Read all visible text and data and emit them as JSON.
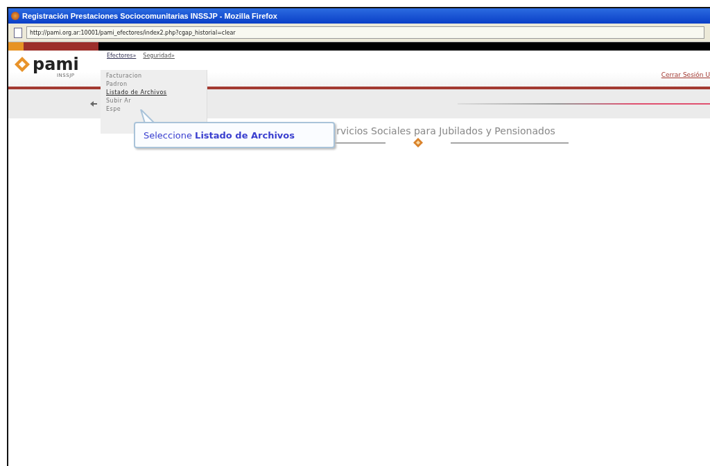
{
  "window": {
    "title": "Registración Prestaciones Sociocomunitarias INSSJP - Mozilla Firefox"
  },
  "address_bar": {
    "url": "http://pami.org.ar:10001/pami_efectores/index2.php?cgap_historial=clear"
  },
  "logo": {
    "name": "pami",
    "subtitle": "INSSJP"
  },
  "menu": [
    {
      "label": "Efectores»",
      "expanded": true
    },
    {
      "label": "Seguridad»",
      "expanded": false
    }
  ],
  "dropdown": [
    {
      "label": "Facturacion",
      "selected": false
    },
    {
      "label": "Padron",
      "selected": false
    },
    {
      "label": "Listado de Archivos",
      "selected": true
    },
    {
      "label": "Subir Ar",
      "selected": false
    },
    {
      "label": "Espe",
      "selected": false
    }
  ],
  "logout_link": "Cerrar Sesión U",
  "tooltip": {
    "text": "Seleccione **Listado de Archivos**"
  },
  "heading": "rvicios Sociales para Jubilados y Pensionados"
}
